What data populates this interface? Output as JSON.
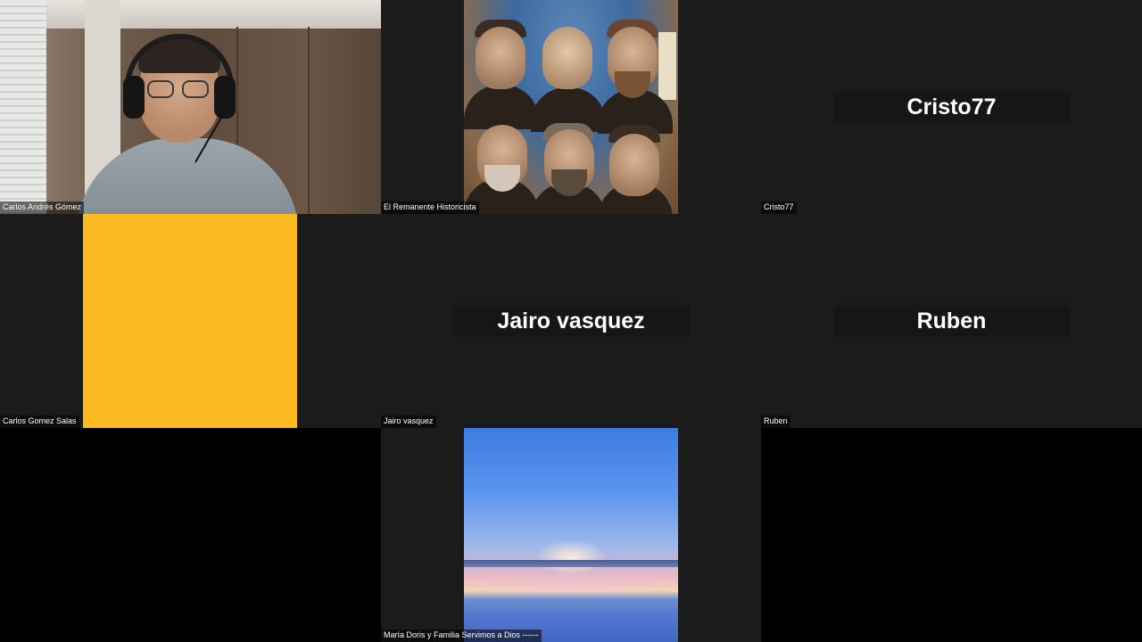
{
  "participants": [
    {
      "name": "Carlos Andrés Gómez",
      "type": "video"
    },
    {
      "name": "El Remanente Historicista",
      "type": "image"
    },
    {
      "name": "Cristo77",
      "type": "avatar-name",
      "display_name": "Cristo77"
    },
    {
      "name": "Carlos Gomez Salas",
      "type": "image"
    },
    {
      "name": "Jairo vasquez",
      "type": "avatar-name",
      "display_name": "Jairo vasquez"
    },
    {
      "name": "Ruben",
      "type": "avatar-name",
      "display_name": "Ruben"
    },
    {
      "name": "",
      "type": "empty"
    },
    {
      "name": "María Doris y Familia Servimos a Dios ------",
      "type": "image"
    },
    {
      "name": "",
      "type": "empty"
    }
  ],
  "colors": {
    "tile_background": "#1b1b1b",
    "empty_tile": "#000000",
    "yellow_avatar": "#fbb922",
    "name_text": "#ffffff"
  }
}
